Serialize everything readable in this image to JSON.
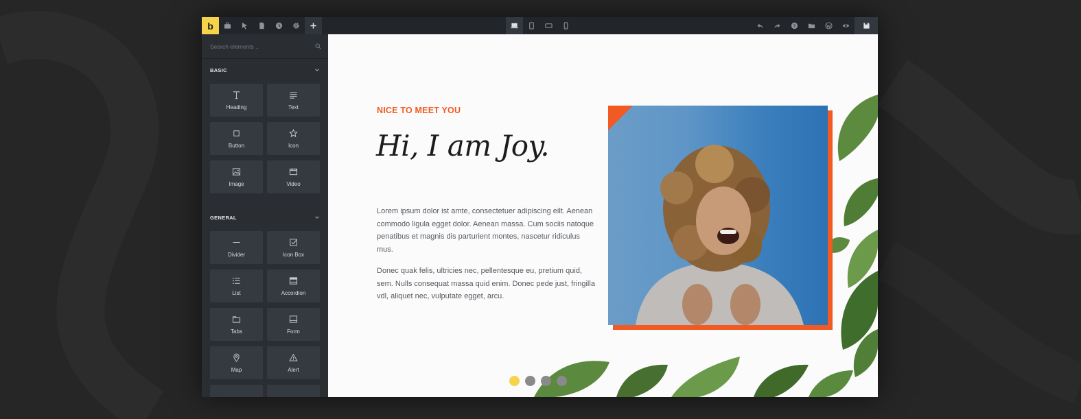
{
  "app": {
    "logo_letter": "b",
    "brand_color": "#f5d34b",
    "accent": "#f15a22"
  },
  "toolbar": {
    "left": [
      "briefcase-icon",
      "cursor-icon",
      "page-icon",
      "history-icon",
      "gear-icon",
      "plus-icon"
    ],
    "center": [
      "desktop-icon",
      "tablet-portrait-icon",
      "tablet-landscape-icon",
      "mobile-icon"
    ],
    "right": [
      "undo-icon",
      "redo-icon",
      "help-icon",
      "folder-icon",
      "wordpress-icon",
      "eye-icon",
      "save-icon"
    ]
  },
  "sidebar": {
    "search_placeholder": "Search elements ..",
    "sections": [
      {
        "title": "BASIC",
        "items": [
          {
            "label": "Heading",
            "icon": "heading-icon"
          },
          {
            "label": "Text",
            "icon": "text-icon"
          },
          {
            "label": "Button",
            "icon": "button-icon"
          },
          {
            "label": "Icon",
            "icon": "star-icon"
          },
          {
            "label": "Image",
            "icon": "image-icon"
          },
          {
            "label": "Video",
            "icon": "video-icon"
          }
        ]
      },
      {
        "title": "GENERAL",
        "items": [
          {
            "label": "Divider",
            "icon": "divider-icon"
          },
          {
            "label": "Icon Box",
            "icon": "icon-box-icon"
          },
          {
            "label": "List",
            "icon": "list-icon"
          },
          {
            "label": "Accordion",
            "icon": "accordion-icon"
          },
          {
            "label": "Tabs",
            "icon": "tabs-icon"
          },
          {
            "label": "Form",
            "icon": "form-icon"
          },
          {
            "label": "Map",
            "icon": "map-pin-icon"
          },
          {
            "label": "Alert",
            "icon": "alert-icon"
          }
        ]
      }
    ]
  },
  "canvas": {
    "kicker": "NICE TO MEET YOU",
    "greeting": "Hi, I am Joy.",
    "paragraph_1": "Lorem ipsum dolor ist amte, consectetuer adipiscing eilt. Aenean commodo ligula egget dolor. Aenean massa. Cum sociis natoque penatibus et magnis dis parturient montes, nascetur ridiculus mus.",
    "paragraph_2": "Donec quak felis, ultricies nec, pellentesque eu, pretium quid, sem. Nulls consequat massa quid enim. Donec pede just, fringilla vdl, aliquet nec, vulputate egget, arcu.",
    "slider_dots": 4,
    "active_dot": 1
  }
}
